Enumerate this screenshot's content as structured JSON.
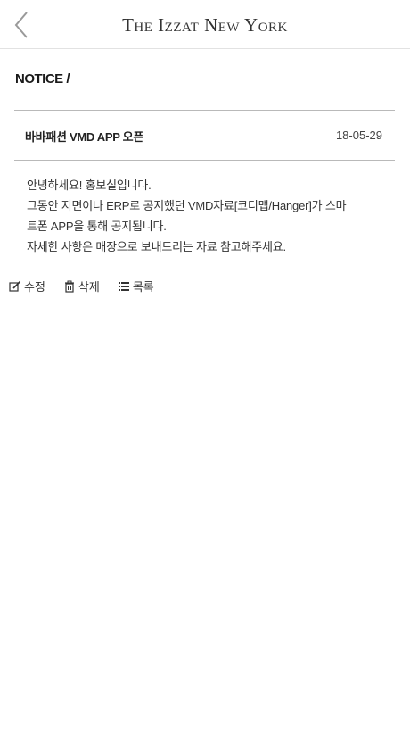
{
  "header": {
    "back_icon": "chevron-left-icon",
    "brand": "The Izzat New York"
  },
  "section": {
    "title": "NOTICE /"
  },
  "notice": {
    "subject": "바바패션 VMD APP 오픈",
    "date": "18-05-29",
    "body": [
      "안녕하세요! 홍보실입니다.",
      "그동안 지면이나 ERP로 공지했던 VMD자료[코디맵/Hanger]가 스마",
      "트폰 APP을 통해 공지됩니다.",
      "자세한 사항은 매장으로 보내드리는 자료 참고해주세요."
    ]
  },
  "actions": {
    "edit": {
      "label": "수정",
      "icon": "edit-icon"
    },
    "delete": {
      "label": "삭제",
      "icon": "trash-icon"
    },
    "list": {
      "label": "목록",
      "icon": "list-icon"
    }
  }
}
